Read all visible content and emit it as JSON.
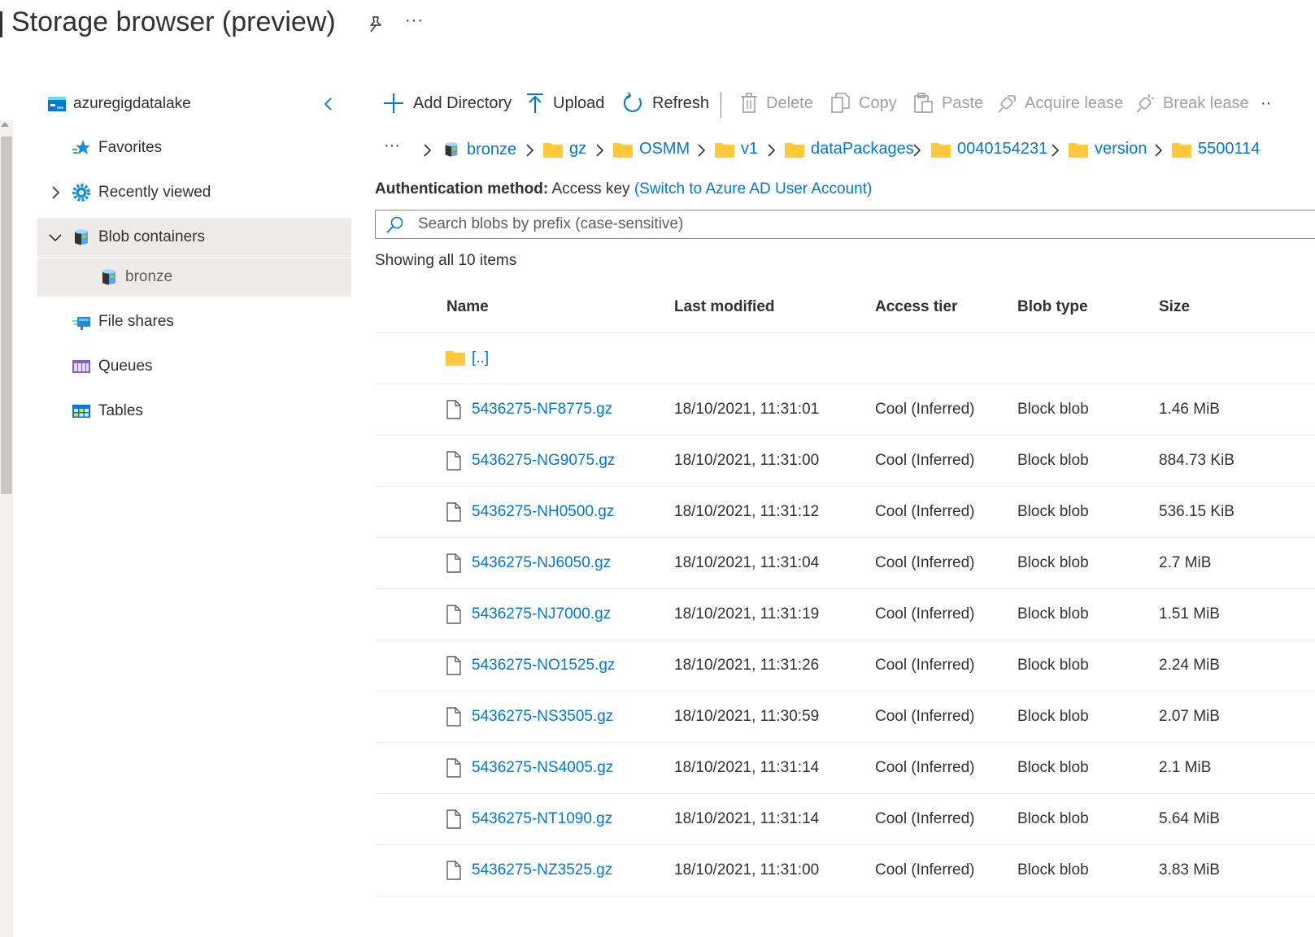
{
  "header": {
    "title": "Storage browser (preview)",
    "pin_icon": "pin-icon",
    "more_label": "···"
  },
  "sidebar": {
    "account": "azuregigdatalake",
    "collapse_icon": "chevron-left-icon",
    "items": [
      {
        "label": "Favorites",
        "icon": "star-icon"
      },
      {
        "label": "Recently viewed",
        "icon": "gear-icon"
      },
      {
        "label": "Blob containers",
        "icon": "blob-container-icon"
      },
      {
        "label": "bronze",
        "icon": "container-icon"
      },
      {
        "label": "File shares",
        "icon": "file-share-icon"
      },
      {
        "label": "Queues",
        "icon": "queue-icon"
      },
      {
        "label": "Tables",
        "icon": "table-icon"
      }
    ]
  },
  "toolbar": {
    "add_directory": "Add Directory",
    "upload": "Upload",
    "refresh": "Refresh",
    "delete": "Delete",
    "copy": "Copy",
    "paste": "Paste",
    "acquire_lease": "Acquire lease",
    "break_lease": "Break lease",
    "overflow": "··"
  },
  "breadcrumb": {
    "overflow": "···",
    "items": [
      "bronze",
      "gz",
      "OSMM",
      "v1",
      "dataPackages",
      "0040154231",
      "version",
      "5500114"
    ]
  },
  "auth": {
    "label": "Authentication method:",
    "value": "Access key",
    "switch_link": "(Switch to Azure AD User Account)"
  },
  "search": {
    "placeholder": "Search blobs by prefix (case-sensitive)",
    "value": ""
  },
  "list": {
    "count_text": "Showing all 10 items",
    "columns": [
      "Name",
      "Last modified",
      "Access tier",
      "Blob type",
      "Size"
    ],
    "parent_label": "[..]",
    "rows": [
      {
        "name": "5436275-NF8775.gz",
        "modified": "18/10/2021, 11:31:01",
        "tier": "Cool (Inferred)",
        "type": "Block blob",
        "size": "1.46 MiB"
      },
      {
        "name": "5436275-NG9075.gz",
        "modified": "18/10/2021, 11:31:00",
        "tier": "Cool (Inferred)",
        "type": "Block blob",
        "size": "884.73 KiB"
      },
      {
        "name": "5436275-NH0500.gz",
        "modified": "18/10/2021, 11:31:12",
        "tier": "Cool (Inferred)",
        "type": "Block blob",
        "size": "536.15 KiB"
      },
      {
        "name": "5436275-NJ6050.gz",
        "modified": "18/10/2021, 11:31:04",
        "tier": "Cool (Inferred)",
        "type": "Block blob",
        "size": "2.7 MiB"
      },
      {
        "name": "5436275-NJ7000.gz",
        "modified": "18/10/2021, 11:31:19",
        "tier": "Cool (Inferred)",
        "type": "Block blob",
        "size": "1.51 MiB"
      },
      {
        "name": "5436275-NO1525.gz",
        "modified": "18/10/2021, 11:31:26",
        "tier": "Cool (Inferred)",
        "type": "Block blob",
        "size": "2.24 MiB"
      },
      {
        "name": "5436275-NS3505.gz",
        "modified": "18/10/2021, 11:30:59",
        "tier": "Cool (Inferred)",
        "type": "Block blob",
        "size": "2.07 MiB"
      },
      {
        "name": "5436275-NS4005.gz",
        "modified": "18/10/2021, 11:31:14",
        "tier": "Cool (Inferred)",
        "type": "Block blob",
        "size": "2.1 MiB"
      },
      {
        "name": "5436275-NT1090.gz",
        "modified": "18/10/2021, 11:31:14",
        "tier": "Cool (Inferred)",
        "type": "Block blob",
        "size": "5.64 MiB"
      },
      {
        "name": "5436275-NZ3525.gz",
        "modified": "18/10/2021, 11:31:00",
        "tier": "Cool (Inferred)",
        "type": "Block blob",
        "size": "3.83 MiB"
      }
    ]
  },
  "colors": {
    "accent": "#0078d4",
    "text": "#323130",
    "disabled": "#a19f9d",
    "folder": "#ffc83d",
    "selected_bg": "#edebe9"
  }
}
